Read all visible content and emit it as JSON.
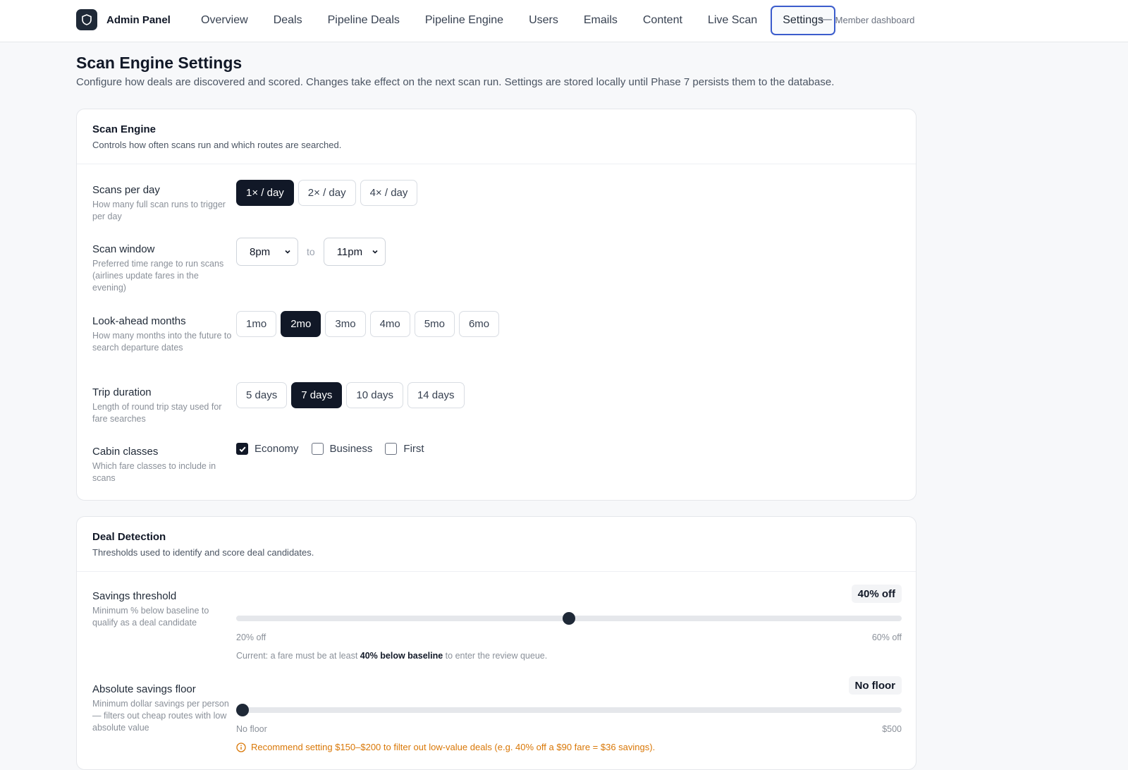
{
  "header": {
    "brand": "Admin Panel",
    "nav": [
      {
        "label": "Overview",
        "active": false
      },
      {
        "label": "Deals",
        "active": false
      },
      {
        "label": "Pipeline Deals",
        "active": false
      },
      {
        "label": "Pipeline Engine",
        "active": false
      },
      {
        "label": "Users",
        "active": false
      },
      {
        "label": "Emails",
        "active": false
      },
      {
        "label": "Content",
        "active": false
      },
      {
        "label": "Live Scan",
        "active": false
      },
      {
        "label": "Settings",
        "active": true
      }
    ],
    "back_link": "Member dashboard",
    "back_arrow": "⟵"
  },
  "page": {
    "title": "Scan Engine Settings",
    "description": "Configure how deals are discovered and scored. Changes take effect on the next scan run. Settings are stored locally until Phase 7 persists them to the database."
  },
  "scan_engine": {
    "title": "Scan Engine",
    "subtitle": "Controls how often scans run and which routes are searched.",
    "scans_per_day": {
      "label": "Scans per day",
      "help": "How many full scan runs to trigger per day",
      "options": [
        "1× / day",
        "2× / day",
        "4× / day"
      ],
      "selected_index": 0
    },
    "scan_window": {
      "label": "Scan window",
      "help": "Preferred time range to run scans (airlines update fares in the evening)",
      "from": "8pm",
      "to_text": "to",
      "to": "11pm"
    },
    "look_ahead": {
      "label": "Look-ahead months",
      "help": "How many months into the future to search departure dates",
      "options": [
        "1mo",
        "2mo",
        "3mo",
        "4mo",
        "5mo",
        "6mo"
      ],
      "selected_index": 1
    },
    "trip_duration": {
      "label": "Trip duration",
      "help": "Length of round trip stay used for fare searches",
      "options": [
        "5 days",
        "7 days",
        "10 days",
        "14 days"
      ],
      "selected_index": 1
    },
    "cabin_classes": {
      "label": "Cabin classes",
      "help": "Which fare classes to include in scans",
      "options": [
        {
          "label": "Economy",
          "checked": true
        },
        {
          "label": "Business",
          "checked": false
        },
        {
          "label": "First",
          "checked": false
        }
      ]
    }
  },
  "deal_detection": {
    "title": "Deal Detection",
    "subtitle": "Thresholds used to identify and score deal candidates.",
    "savings_threshold": {
      "label": "Savings threshold",
      "help": "Minimum % below baseline to qualify as a deal candidate",
      "value_badge": "40% off",
      "value": 40,
      "min": 20,
      "max": 60,
      "min_label": "20% off",
      "max_label": "60% off",
      "note_prefix": "Current: a fare must be at least ",
      "note_bold": "40% below baseline",
      "note_suffix": " to enter the review queue."
    },
    "savings_floor": {
      "label": "Absolute savings floor",
      "help": "Minimum dollar savings per person — filters out cheap routes with low absolute value",
      "value_badge": "No floor",
      "value": 0,
      "min": 0,
      "max": 500,
      "min_label": "No floor",
      "max_label": "$500",
      "warning": "Recommend setting $150–$200 to filter out low-value deals (e.g. 40% off a $90 fare = $36 savings).",
      "warning_color": "#d97706"
    }
  },
  "colors": {
    "accent_active_border": "#3b5ccc",
    "selected_bg": "#111827",
    "warning": "#d97706"
  }
}
